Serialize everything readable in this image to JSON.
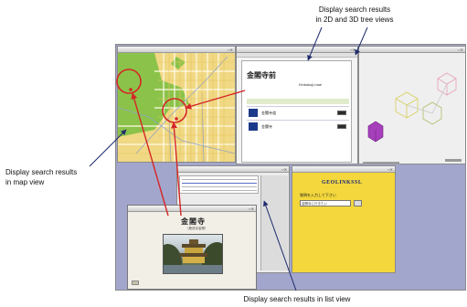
{
  "captions": {
    "top": [
      "Display search results",
      "in 2D and 3D tree views"
    ],
    "left": [
      "Display search results",
      "in map view"
    ],
    "bottom": "Display search results in list view"
  },
  "windows": {
    "map": {
      "title": ""
    },
    "info": {
      "title": "",
      "heading": "金閣寺前",
      "subtitle": "Kinkakuji-mae",
      "rows": [
        "金閣寺道",
        "金閣寺"
      ]
    },
    "tree": {
      "title": ""
    },
    "list": {
      "title": ""
    },
    "image": {
      "title": "金閣寺",
      "subtitle": "（鹿苑寺金閣）"
    },
    "yellow": {
      "title": "GEOLINKSSL",
      "prompt": "質問を入力して下さい",
      "input_value": "金閣寺に行きたい"
    }
  },
  "colors": {
    "desktop": "#a3a6cc",
    "annotation_red": "#d42626",
    "arrow_blue": "#1d2a6d",
    "map_green": "#8bc34a",
    "map_yellow": "#f0d884",
    "yellow_panel": "#f3d73c",
    "cube_magenta": "#a63fba"
  }
}
